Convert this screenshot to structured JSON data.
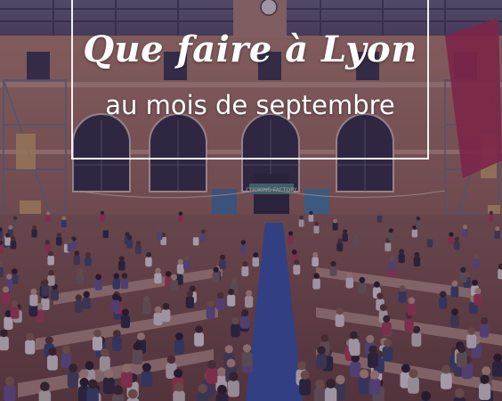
{
  "title": {
    "main": "Que faire à Lyon",
    "sub": "au mois de septembre"
  },
  "photo": {
    "sign_text": "COOKING FACTORY",
    "colors": {
      "facade": "#a8745e",
      "floor": "#8a5a44",
      "overlay": "#2a1646",
      "aisle": "#3a59a8",
      "banner_right": "#b0304a"
    }
  }
}
